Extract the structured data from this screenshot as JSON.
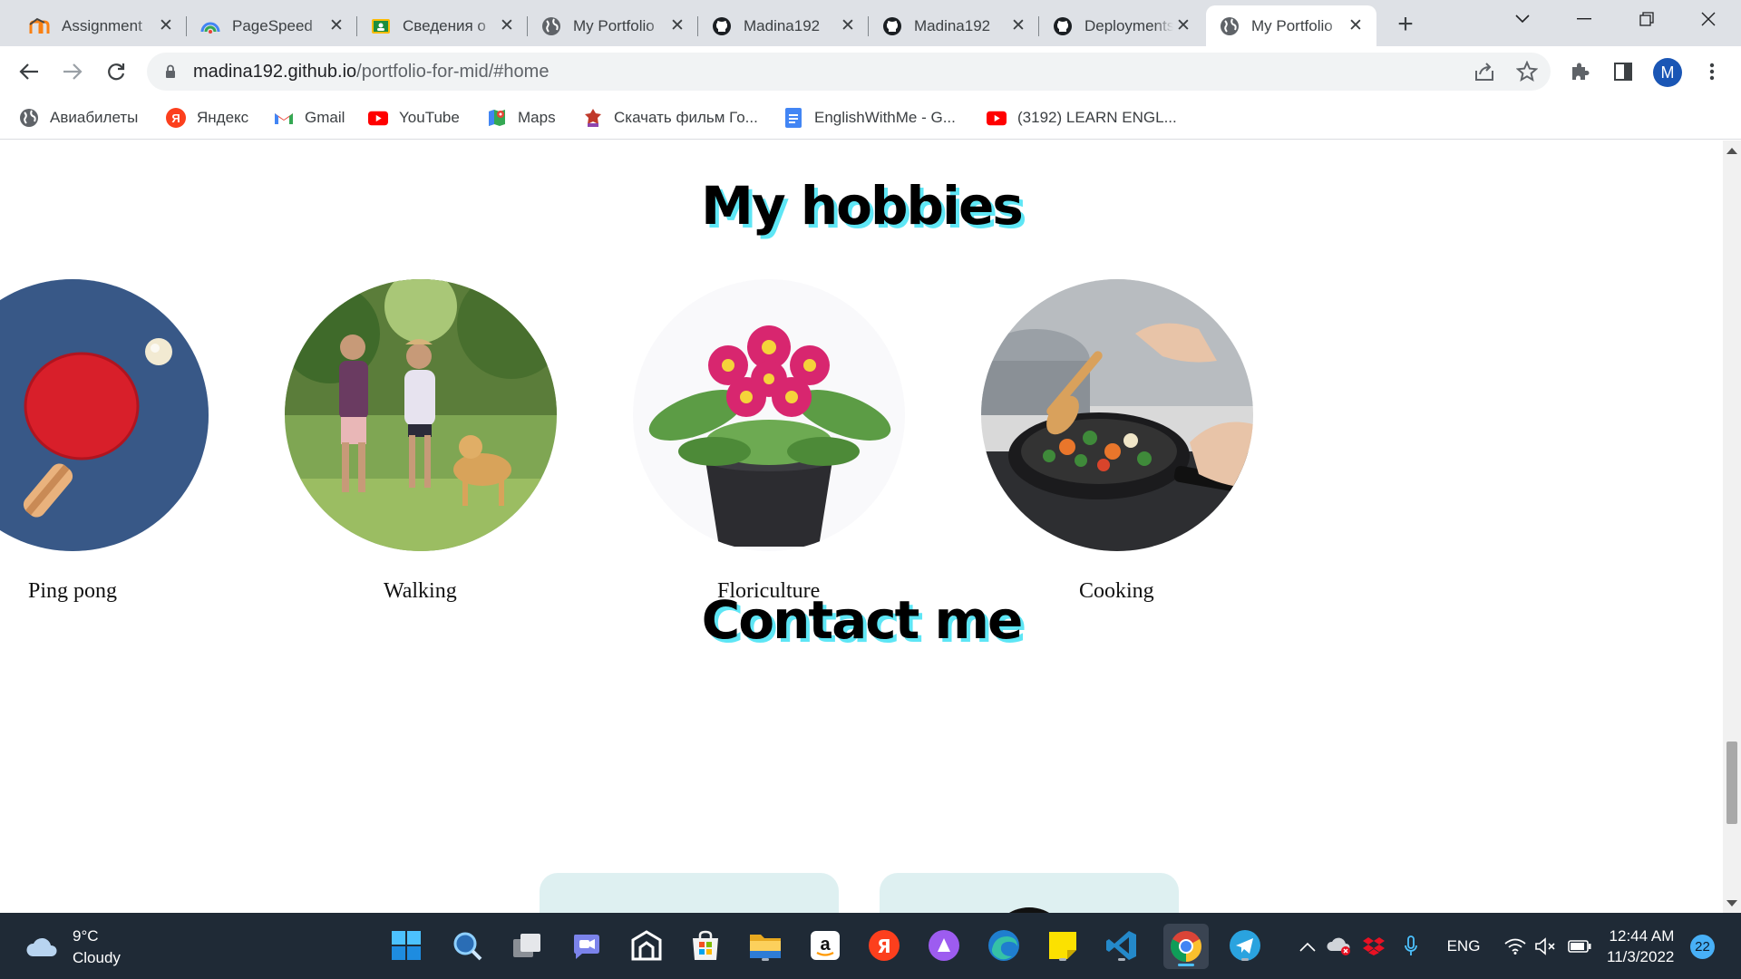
{
  "browser": {
    "tabs": [
      {
        "title": "Assignment",
        "icon": "moodle-icon"
      },
      {
        "title": "PageSpeed",
        "icon": "pagespeed-icon"
      },
      {
        "title": "Сведения о",
        "icon": "classroom-icon"
      },
      {
        "title": "My Portfolio",
        "icon": "globe-icon"
      },
      {
        "title": "Madina192",
        "icon": "github-icon"
      },
      {
        "title": "Madina192",
        "icon": "github-icon"
      },
      {
        "title": "Deployments",
        "icon": "github-icon"
      },
      {
        "title": "My Portfolio",
        "icon": "globe-icon",
        "active": true
      }
    ],
    "new_tab": "+",
    "url_host": "madina192.github.io",
    "url_path": "/portfolio-for-mid/#home",
    "profile_initial": "M",
    "bookmarks": [
      {
        "label": "Авиабилеты",
        "icon": "globe-icon"
      },
      {
        "label": "Яндекс",
        "icon": "yandex-icon"
      },
      {
        "label": "Gmail",
        "icon": "gmail-icon"
      },
      {
        "label": "YouTube",
        "icon": "youtube-icon"
      },
      {
        "label": "Maps",
        "icon": "maps-icon"
      },
      {
        "label": "Скачать фильм Го...",
        "icon": "film-icon"
      },
      {
        "label": "EnglishWithMe - G...",
        "icon": "docs-icon"
      },
      {
        "label": "(3192) LEARN ENGL...",
        "icon": "youtube-icon"
      }
    ]
  },
  "page": {
    "hobbies_title": "My hobbies",
    "hobbies": [
      {
        "label": "Ping pong"
      },
      {
        "label": "Walking"
      },
      {
        "label": "Floriculture"
      },
      {
        "label": "Cooking"
      }
    ],
    "contact_title": "Contact me",
    "colors": {
      "title_shadow": "#5ee6f5",
      "card_bg": "#def0f1"
    }
  },
  "taskbar": {
    "weather_temp": "9°C",
    "weather_desc": "Cloudy",
    "language": "ENG",
    "time": "12:44 AM",
    "date": "11/3/2022",
    "notifications": "22"
  }
}
